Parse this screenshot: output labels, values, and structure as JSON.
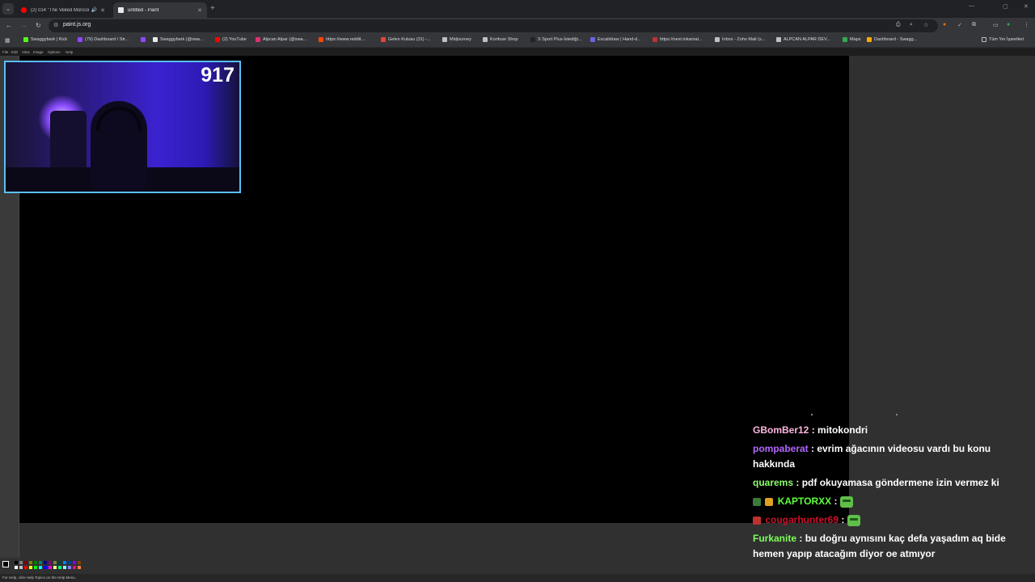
{
  "browser": {
    "tabs": [
      {
        "title": "(2) 014 \"The Veiled Moncoi...",
        "active": false,
        "audio": true
      },
      {
        "title": "untitled - Paint",
        "active": true,
        "audio": false
      }
    ],
    "url": "paint.js.org",
    "bookmarks": [
      {
        "label": "Swaggybark | Kick",
        "color": "#53fc18"
      },
      {
        "label": "(79) Dashboard / Str...",
        "color": "#9146ff"
      },
      {
        "label": "",
        "color": "#9146ff"
      },
      {
        "label": "Swaggybark (@swa...",
        "color": "#e8eaed"
      },
      {
        "label": "(2) YouTube",
        "color": "#ff0000"
      },
      {
        "label": "Alpcan Alpar (@swa...",
        "color": "#e1306c"
      },
      {
        "label": "https://www.reddit....",
        "color": "#ff4500"
      },
      {
        "label": "Gelen Kutusu (31) -...",
        "color": "#ea4335"
      },
      {
        "label": "Midjourney",
        "color": "#bdc1c6"
      },
      {
        "label": "Konfuse Shop",
        "color": "#bdc1c6"
      },
      {
        "label": "S Sport Plus-İstediği...",
        "color": "#202124"
      },
      {
        "label": "Excalidraw | Hand-d...",
        "color": "#6965db"
      },
      {
        "label": "https://next.inkarnat...",
        "color": "#b33"
      },
      {
        "label": "Inbox - Zoho Mail (s...",
        "color": "#bdc1c6"
      },
      {
        "label": "ALPCAN ALPAR DEV...",
        "color": "#bdc1c6"
      },
      {
        "label": "Maps",
        "color": "#34a853"
      },
      {
        "label": "Dashboard - Swagg...",
        "color": "#f9ab00"
      }
    ],
    "all_bookmarks": "Tüm Yer İşaretleri"
  },
  "paint": {
    "menu": [
      "File",
      "Edit",
      "View",
      "Image",
      "Options",
      "Help"
    ],
    "status": "For Help, click Help Topics on the Help Menu."
  },
  "webcam": {
    "viewer_count": "917"
  },
  "chat": {
    "messages": [
      {
        "user": "GBomBer12",
        "color": "#ffb6e0",
        "text": "mitokondri",
        "emote": false,
        "badges": []
      },
      {
        "user": "pompaberat",
        "color": "#b266ff",
        "text": "evrim ağacının videosu vardı bu konu hakkında",
        "emote": false,
        "badges": []
      },
      {
        "user": "quarems",
        "color": "#8cff6b",
        "text": "pdf okuyamasa göndermene izin vermez ki",
        "emote": false,
        "badges": []
      },
      {
        "user": "KAPTORXX",
        "color": "#5dff3a",
        "text": "",
        "emote": true,
        "badges": [
          "#3b7a3b",
          "#e0a020"
        ]
      },
      {
        "user": "cougarhunter69",
        "color": "#d0102a",
        "text": "",
        "emote": true,
        "badges": [
          "#c03030"
        ]
      },
      {
        "user": "Furkanite",
        "color": "#7dff5a",
        "text": "bu doğru aynısını kaç defa yaşadım aq bide hemen yapıp atacağım diyor oe atmıyor",
        "emote": false,
        "badges": []
      }
    ]
  }
}
